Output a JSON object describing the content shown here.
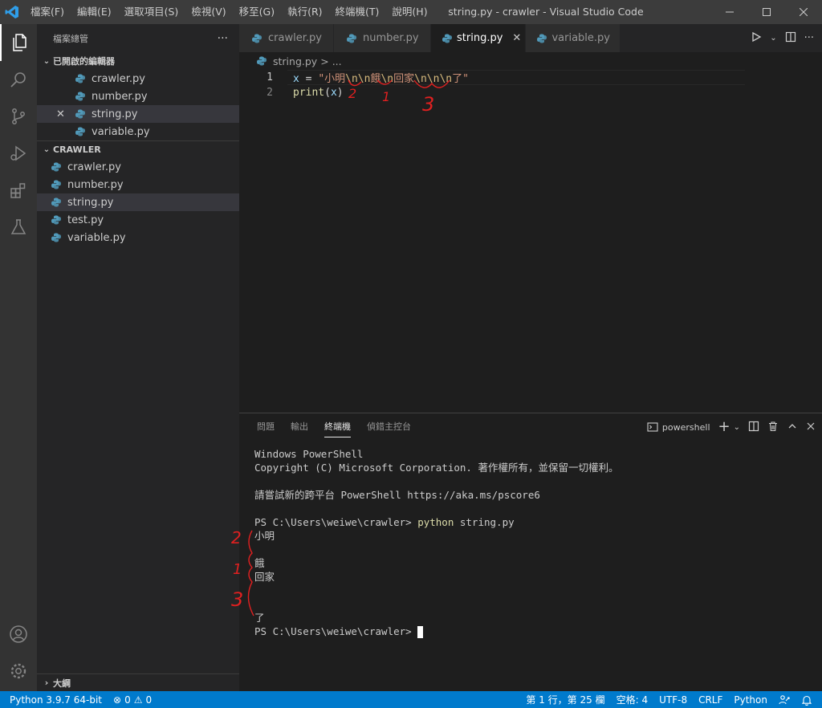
{
  "titlebar": {
    "menu": [
      "檔案(F)",
      "編輯(E)",
      "選取項目(S)",
      "檢視(V)",
      "移至(G)",
      "執行(R)",
      "終端機(T)",
      "說明(H)"
    ],
    "title": "string.py - crawler - Visual Studio Code"
  },
  "sidebar": {
    "header": "檔案總管",
    "more": "···",
    "open_editors_label": "已開啟的編輯器",
    "open_editors": [
      "crawler.py",
      "number.py",
      "string.py",
      "variable.py"
    ],
    "folder_label": "CRAWLER",
    "files": [
      "crawler.py",
      "number.py",
      "string.py",
      "test.py",
      "variable.py"
    ],
    "outline_label": "大綱"
  },
  "tabs": [
    "crawler.py",
    "number.py",
    "string.py",
    "variable.py"
  ],
  "breadcrumb": {
    "file": "string.py",
    "sep": ">",
    "rest": "..."
  },
  "editor": {
    "line_numbers": [
      "1",
      "2"
    ],
    "line1": {
      "var": "x",
      "eq": " = ",
      "q1": "\"",
      "s1": "小明",
      "e1": "\\n\\n",
      "s2": "餓",
      "e2": "\\n",
      "s3": "回家",
      "e3": "\\n\\n\\n",
      "s4": "了",
      "q2": "\""
    },
    "line2": {
      "fn": "print",
      "open": "(",
      "arg": "x",
      "close": ")"
    }
  },
  "panel": {
    "tabs": [
      "問題",
      "輸出",
      "終端機",
      "偵錯主控台"
    ],
    "shell": "powershell",
    "terminal": {
      "l1": "Windows PowerShell",
      "l2": "Copyright (C) Microsoft Corporation. 著作權所有，並保留一切權利。",
      "l3": "請嘗試新的跨平台 PowerShell https://aka.ms/pscore6",
      "prompt": "PS C:\\Users\\weiwe\\crawler> ",
      "cmd": "python",
      "args": " string.py",
      "o1": "小明",
      "o2": "餓",
      "o3": "回家",
      "o4": "了",
      "prompt2": "PS C:\\Users\\weiwe\\crawler> "
    }
  },
  "statusbar": {
    "python": "Python 3.9.7 64-bit",
    "errors": "0",
    "warnings": "0",
    "position": "第 1 行，第 25 欄",
    "spaces": "空格: 4",
    "encoding": "UTF-8",
    "eol": "CRLF",
    "language": "Python"
  },
  "annotations": [
    "2",
    "1",
    "3",
    "2",
    "1",
    "3"
  ],
  "colors": {
    "accent": "#007acc",
    "annotation": "#e02020"
  }
}
